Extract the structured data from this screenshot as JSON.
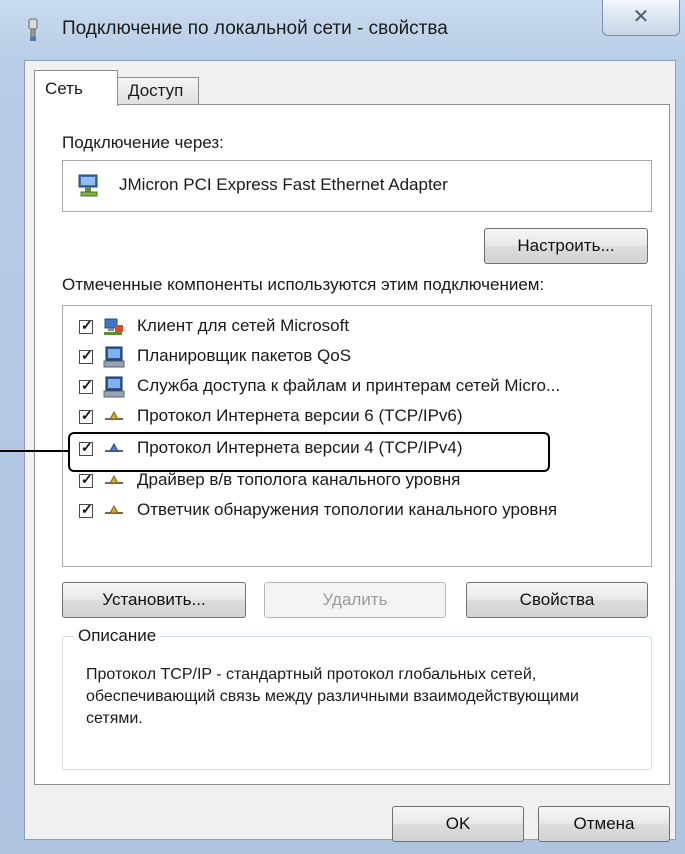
{
  "window": {
    "title": "Подключение по локальной сети - свойства",
    "close_glyph": "✕"
  },
  "tabs": [
    {
      "label": "Сеть",
      "active": true
    },
    {
      "label": "Доступ",
      "active": false
    }
  ],
  "connect_through_label": "Подключение через:",
  "adapter": {
    "name": "JMicron PCI Express Fast Ethernet Adapter",
    "icon": "network-adapter-icon"
  },
  "configure_button": "Настроить...",
  "components_label": "Отмеченные компоненты используются этим подключением:",
  "components": [
    {
      "label": "Клиент для сетей Microsoft",
      "checked": true,
      "icon": "network-client-icon"
    },
    {
      "label": "Планировщик пакетов QoS",
      "checked": true,
      "icon": "computer-service-icon"
    },
    {
      "label": "Служба доступа к файлам и принтерам сетей Micro...",
      "checked": true,
      "icon": "computer-service-icon"
    },
    {
      "label": "Протокол Интернета версии 6 (TCP/IPv6)",
      "checked": true,
      "icon": "protocol-icon"
    },
    {
      "label": "Протокол Интернета версии 4 (TCP/IPv4)",
      "checked": true,
      "icon": "protocol-icon",
      "highlighted": true
    },
    {
      "label": "Драйвер в/в тополога канального уровня",
      "checked": true,
      "icon": "protocol-icon"
    },
    {
      "label": "Ответчик обнаружения топологии канального уровня",
      "checked": true,
      "icon": "protocol-icon"
    }
  ],
  "buttons": {
    "install": "Установить...",
    "remove": "Удалить",
    "properties": "Свойства",
    "ok": "OK",
    "cancel": "Отмена"
  },
  "description": {
    "title": "Описание",
    "text": "Протокол TCP/IP - стандартный протокол глобальных сетей, обеспечивающий связь между различными взаимодействующими сетями."
  },
  "colors": {
    "title_bar": "#b7cde6",
    "dialog_bg": "#f0f0f0",
    "highlight_border": "#000000"
  }
}
